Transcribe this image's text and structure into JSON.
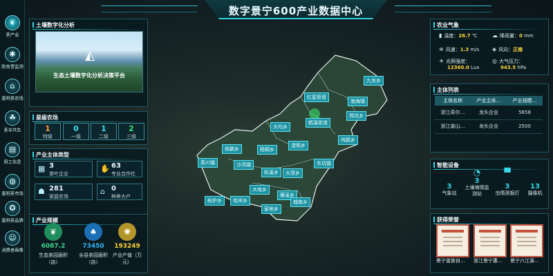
{
  "header": {
    "title": "数字景宁600产业数据中心"
  },
  "sidebar": {
    "items": [
      {
        "label": "茶产业",
        "icon": "leaf-icon"
      },
      {
        "label": "防虫害监测",
        "icon": "bug-icon"
      },
      {
        "label": "惠明茶农场",
        "icon": "farm-icon"
      },
      {
        "label": "茶羊共生",
        "icon": "sheep-icon"
      },
      {
        "label": "用工信息",
        "icon": "worker-icon"
      },
      {
        "label": "惠明茶市场",
        "icon": "market-icon"
      },
      {
        "label": "惠明茶品牌",
        "icon": "brand-icon"
      },
      {
        "label": "消费者画像",
        "icon": "consumer-icon"
      }
    ]
  },
  "soil_panel": {
    "title": "土壤数字化分析",
    "caption": "生态土壤数字化分析决策平台"
  },
  "star_farm": {
    "title": "星级农场",
    "grades": [
      {
        "value": "1",
        "label": "特级",
        "color": "#ff9a2e"
      },
      {
        "value": "0",
        "label": "一级",
        "color": "#2fe0f0"
      },
      {
        "value": "1",
        "label": "二级",
        "color": "#2fe0f0"
      },
      {
        "value": "2",
        "label": "三级",
        "color": "#39e36a"
      }
    ]
  },
  "producer_types": {
    "title": "产业主体类型",
    "items": [
      {
        "value": "3",
        "label": "茶叶企业",
        "icon": "building-icon"
      },
      {
        "value": "63",
        "label": "专业合作社",
        "icon": "handshake-icon"
      },
      {
        "value": "281",
        "label": "家庭农场",
        "icon": "family-icon"
      },
      {
        "value": "0",
        "label": "种养大户",
        "icon": "house-icon"
      }
    ]
  },
  "industry_scale": {
    "title": "产业规模",
    "items": [
      {
        "value": "6087.2",
        "label": "生态茶园面积",
        "unit": "（亩）",
        "color": "#3fd68b"
      },
      {
        "value": "73450",
        "label": "全县茶园面积",
        "unit": "（亩）",
        "color": "#2fb7f5"
      },
      {
        "value": "193249",
        "label": "产业产值（万",
        "unit": "元）",
        "color": "#ffcf2e"
      }
    ]
  },
  "weather": {
    "title": "农业气象",
    "items": [
      {
        "label": "温度：",
        "value": "26.7",
        "unit": "℃",
        "icon": "thermometer-icon"
      },
      {
        "label": "降雨量：",
        "value": "0",
        "unit": "mm",
        "icon": "rain-icon"
      },
      {
        "label": "风速：",
        "value": "1.3",
        "unit": "m/s",
        "icon": "wind-icon"
      },
      {
        "label": "风向：",
        "value": "正南",
        "unit": "",
        "icon": "compass-icon"
      },
      {
        "label": "光照强度：",
        "value": "12360.0",
        "unit": "Lux",
        "icon": "sun-icon"
      },
      {
        "label": "大气压力：",
        "value": "943.5",
        "unit": "hPa",
        "icon": "pressure-icon"
      }
    ]
  },
  "entity_list": {
    "title": "主体列表",
    "columns": [
      "主体名称",
      "产业主体…",
      "产业规模…"
    ],
    "rows": [
      [
        "浙江奇尔…",
        "龙头企业",
        "5658"
      ],
      [
        "浙江畲山…",
        "龙头企业",
        "2500"
      ]
    ]
  },
  "devices": {
    "title": "智能设备",
    "items": [
      {
        "value": "3",
        "label": "气象站",
        "icon": "weather-station-icon"
      },
      {
        "value": "3",
        "label": "土壤墒情监",
        "label2": "测站",
        "icon": "soil-sensor-icon"
      },
      {
        "value": "3",
        "label": "虫情测报灯",
        "icon": "insect-lamp-icon"
      },
      {
        "value": "13",
        "label": "摄像机",
        "icon": "camera-icon"
      }
    ]
  },
  "honors": {
    "title": "获得荣誉",
    "items": [
      {
        "label": "景宁畲族自…"
      },
      {
        "label": "浙江景宁惠…"
      },
      {
        "label": "景宁六江源…"
      }
    ]
  },
  "map": {
    "townships": [
      "九龙乡",
      "红星街道",
      "渤海镇",
      "郑坑乡",
      "大均乡",
      "鹤溪街道",
      "梧桐乡",
      "澄照乡",
      "鸬鹚乡",
      "尚鹏乡",
      "英川镇",
      "沙湾镇",
      "标溪乡",
      "东坑镇",
      "大漈乡",
      "大地乡",
      "雁溪乡",
      "秋炉乡",
      "毛垟乡",
      "家地乡",
      "城南乡"
    ]
  }
}
